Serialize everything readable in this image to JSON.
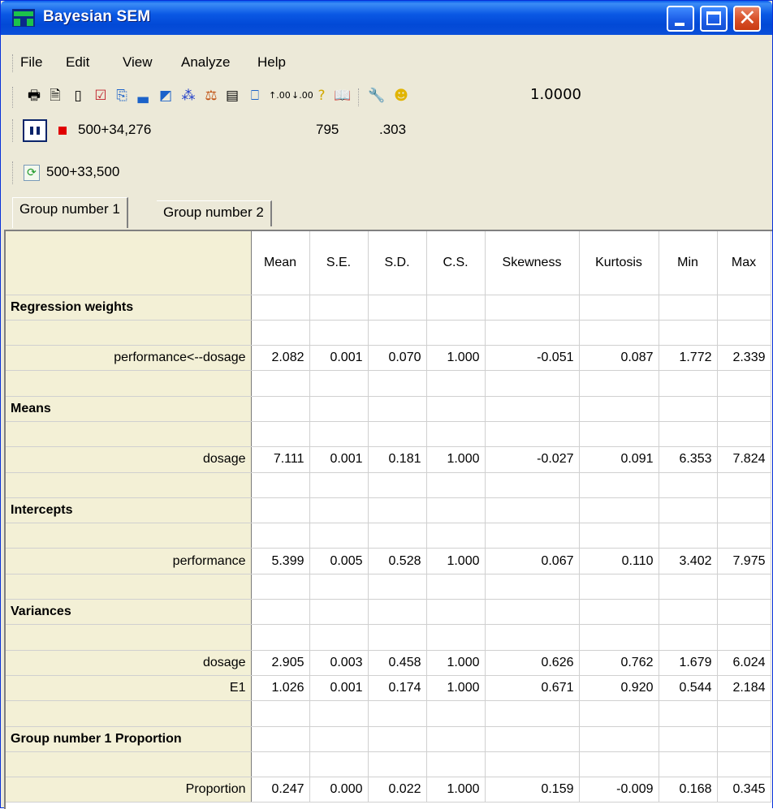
{
  "window": {
    "title": "Bayesian SEM",
    "controls": {
      "minimize": "minimize",
      "maximize": "maximize",
      "close": "close"
    }
  },
  "menu": {
    "items": [
      {
        "label": "File"
      },
      {
        "label": "Edit"
      },
      {
        "label": "View"
      },
      {
        "label": "Analyze"
      },
      {
        "label": "Help"
      }
    ]
  },
  "toolbar": {
    "icons": [
      "print-icon",
      "print-preview-icon",
      "copy-icon",
      "checkbox-icon",
      "clipboard-icon",
      "bar-chart-icon",
      "image-icon",
      "tree-icon",
      "balance-scale-icon",
      "table-icon",
      "posterior-icon",
      "increase-decimals-icon",
      "decrease-decimals-icon",
      "help-pointer-icon",
      "book-icon",
      "wrench-icon",
      "smiley-icon"
    ],
    "zoom_value": "1.0000"
  },
  "status": {
    "samples_text": "500+34,276",
    "count_text": "795",
    "ratio_text": ".303",
    "retained_text": "500+33,500"
  },
  "tabs": [
    {
      "label": "Group number 1",
      "active": true
    },
    {
      "label": "Group number 2",
      "active": false
    }
  ],
  "grid": {
    "columns": [
      "Mean",
      "S.E.",
      "S.D.",
      "C.S.",
      "Skewness",
      "Kurtosis",
      "Min",
      "Max"
    ],
    "rows": [
      {
        "kind": "section",
        "label": "Regression weights"
      },
      {
        "kind": "blank"
      },
      {
        "kind": "data",
        "label": "performance<--dosage",
        "values": [
          "2.082",
          "0.001",
          "0.070",
          "1.000",
          "-0.051",
          "0.087",
          "1.772",
          "2.339"
        ]
      },
      {
        "kind": "blank"
      },
      {
        "kind": "section",
        "label": "Means"
      },
      {
        "kind": "blank"
      },
      {
        "kind": "data",
        "label": "dosage",
        "values": [
          "7.111",
          "0.001",
          "0.181",
          "1.000",
          "-0.027",
          "0.091",
          "6.353",
          "7.824"
        ]
      },
      {
        "kind": "blank"
      },
      {
        "kind": "section",
        "label": "Intercepts"
      },
      {
        "kind": "blank"
      },
      {
        "kind": "data",
        "label": "performance",
        "values": [
          "5.399",
          "0.005",
          "0.528",
          "1.000",
          "0.067",
          "0.110",
          "3.402",
          "7.975"
        ]
      },
      {
        "kind": "blank"
      },
      {
        "kind": "section",
        "label": "Variances"
      },
      {
        "kind": "blank"
      },
      {
        "kind": "data",
        "label": "dosage",
        "values": [
          "2.905",
          "0.003",
          "0.458",
          "1.000",
          "0.626",
          "0.762",
          "1.679",
          "6.024"
        ]
      },
      {
        "kind": "data",
        "label": "E1",
        "values": [
          "1.026",
          "0.001",
          "0.174",
          "1.000",
          "0.671",
          "0.920",
          "0.544",
          "2.184"
        ]
      },
      {
        "kind": "blank"
      },
      {
        "kind": "section",
        "label": "Group number 1 Proportion"
      },
      {
        "kind": "blank"
      },
      {
        "kind": "data",
        "label": "Proportion",
        "values": [
          "0.247",
          "0.000",
          "0.022",
          "1.000",
          "0.159",
          "-0.009",
          "0.168",
          "0.345"
        ]
      }
    ]
  }
}
